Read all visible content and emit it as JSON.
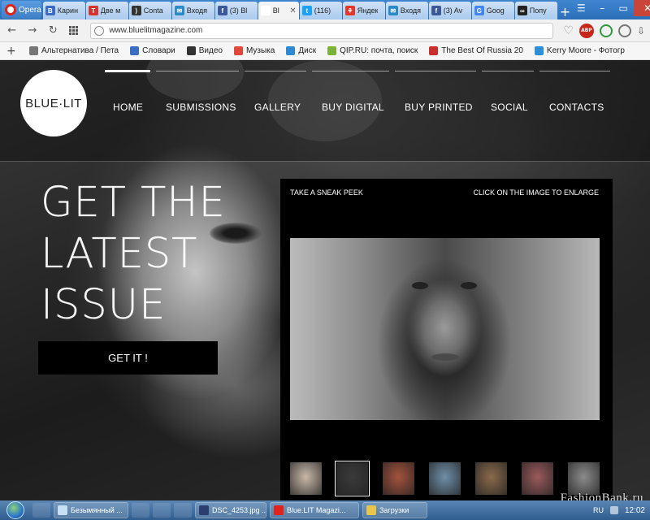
{
  "browser": {
    "menu_label": "Opera",
    "tabs": [
      {
        "title": "Карин",
        "fav_color": "#3b6cc4",
        "fav_glyph": "B"
      },
      {
        "title": "Две м",
        "fav_color": "#d4342c",
        "fav_glyph": "T"
      },
      {
        "title": "Conta",
        "fav_color": "#333333",
        "fav_glyph": "⟩"
      },
      {
        "title": "Входя",
        "fav_color": "#2a8ac8",
        "fav_glyph": "✉"
      },
      {
        "title": "(3) Bl",
        "fav_color": "#3b5998",
        "fav_glyph": "f"
      },
      {
        "title": "Bl",
        "fav_color": "#ffffff",
        "fav_glyph": "",
        "active": true
      },
      {
        "title": "(116)",
        "fav_color": "#1da1f2",
        "fav_glyph": "t"
      },
      {
        "title": "Яндек",
        "fav_color": "#e4362a",
        "fav_glyph": "⚘"
      },
      {
        "title": "Входя",
        "fav_color": "#2a8ac8",
        "fav_glyph": "✉"
      },
      {
        "title": "(3) Av",
        "fav_color": "#3b5998",
        "fav_glyph": "f"
      },
      {
        "title": "Goog",
        "fav_color": "#4285f4",
        "fav_glyph": "G"
      },
      {
        "title": "Попу",
        "fav_color": "#222222",
        "fav_glyph": "∞"
      }
    ],
    "url": "www.bluelitmagazine.com",
    "abp_label": "ABP",
    "bookmarks": [
      {
        "label": "Альтернатива / Пета",
        "color": "#777777"
      },
      {
        "label": "Словари",
        "color": "#3b6cc4"
      },
      {
        "label": "Видео",
        "color": "#333333"
      },
      {
        "label": "Музыка",
        "color": "#e0483c"
      },
      {
        "label": "Диск",
        "color": "#2d8ad0"
      },
      {
        "label": "QIP.RU: почта, поиск",
        "color": "#7bb33a"
      },
      {
        "label": "The Best Of Russia 20",
        "color": "#c9302c"
      },
      {
        "label": "Kerry Moore - Фотогр",
        "color": "#2e8fd6"
      }
    ]
  },
  "site": {
    "logo_text": "BLUE·LIT",
    "nav": [
      {
        "label": "HOME",
        "active": true
      },
      {
        "label": "SUBMISSIONS"
      },
      {
        "label": "GALLERY"
      },
      {
        "label": "BUY DIGITAL"
      },
      {
        "label": "BUY PRINTED"
      },
      {
        "label": "SOCIAL"
      },
      {
        "label": "CONTACTS"
      }
    ],
    "headline_lines": [
      "GET THE",
      "LATEST",
      "ISSUE"
    ],
    "cta_label": "GET IT !",
    "preview": {
      "left_label": "TAKE A SNEAK PEEK",
      "right_label": "CLICK ON THE IMAGE TO ENLARGE",
      "thumbnail_colors": [
        "#c9b8a8",
        "#3a3a3a",
        "#a5523d",
        "#6f8fa8",
        "#8a6a4a",
        "#9b5a5a",
        "#8c8c8c"
      ],
      "selected_thumb": 1
    }
  },
  "taskbar": {
    "buttons": [
      {
        "label": "Безымянный ...",
        "color": "#c8e0f5"
      },
      {
        "label": "DSC_4253.jpg ...",
        "color": "#2a3f70"
      },
      {
        "label": "Blue.LIT Magazi...",
        "color": "#e2231a"
      },
      {
        "label": "Загрузки",
        "color": "#e8c64a"
      }
    ],
    "lang": "RU",
    "clock": "12:02"
  },
  "watermark": "FashionBank.ru"
}
